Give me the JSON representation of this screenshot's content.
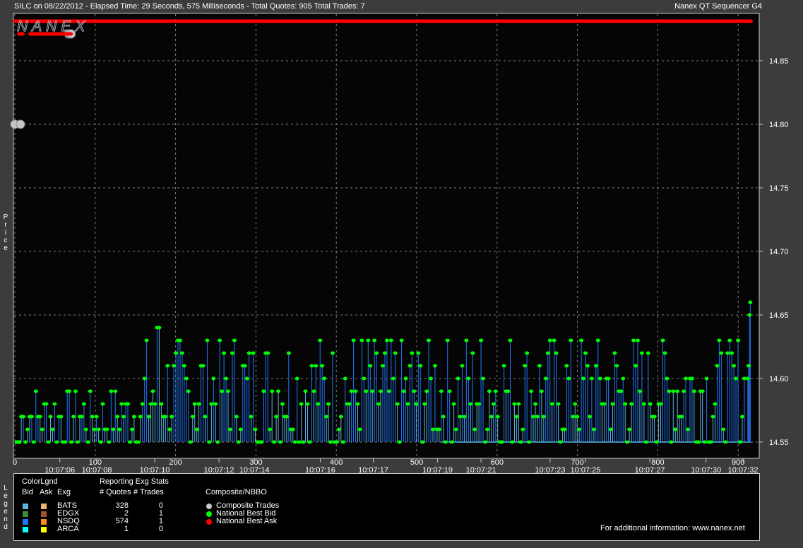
{
  "header": {
    "left": "SILC on 08/22/2012  -  Elapsed Time: 29 Seconds, 575 Milliseconds  -  Total Quotes: 905  Total Trades: 7",
    "right": "Nanex QT Sequencer G4"
  },
  "watermark": "NANEX",
  "y_axis_label": "Price",
  "legend_side_label": "Legend",
  "chart_data": {
    "type": "scatter",
    "ylabel": "Price",
    "ylim": [
      14.545,
      14.875
    ],
    "xlim": [
      0,
      920
    ],
    "y_ticks": [
      "14.55",
      "14.60",
      "14.65",
      "14.70",
      "14.75",
      "14.80",
      "14.85"
    ],
    "x_ticks": [
      "0",
      "100",
      "200",
      "300",
      "400",
      "500",
      "600",
      "700",
      "800",
      "900"
    ],
    "time_labels": [
      {
        "x": 28,
        "label": "10:07:06"
      },
      {
        "x": 51,
        "label": "10:07:08"
      },
      {
        "x": 87,
        "label": "10:07:10"
      },
      {
        "x": 127,
        "label": "10:07:12"
      },
      {
        "x": 149,
        "label": "10:07:14"
      },
      {
        "x": 190,
        "label": "10:07:16"
      },
      {
        "x": 223,
        "label": "10:07:17"
      },
      {
        "x": 263,
        "label": "10:07:19"
      },
      {
        "x": 290,
        "label": "10:07:21"
      },
      {
        "x": 333,
        "label": "10:07:23"
      },
      {
        "x": 355,
        "label": "10:07:25"
      },
      {
        "x": 395,
        "label": "10:07:27"
      },
      {
        "x": 430,
        "label": "10:07:30"
      },
      {
        "x": 453,
        "label": "10:07:32"
      }
    ],
    "grid": true,
    "series": [
      {
        "name": "National Best Ask",
        "color": "#ff0000",
        "segments": [
          [
            0,
            14.875,
            70,
            14.875
          ],
          [
            5,
            14.865,
            10,
            14.865
          ],
          [
            19,
            14.865,
            70,
            14.865
          ],
          [
            70,
            14.875,
            916,
            14.875
          ]
        ]
      },
      {
        "name": "Composite Trades",
        "color": "#c8c8c8",
        "values": [
          [
            0,
            14.8
          ],
          [
            7,
            14.8
          ],
          [
            67,
            14.865
          ],
          [
            69,
            14.865
          ],
          [
            70,
            14.865
          ]
        ]
      },
      {
        "name": "National Best Bid",
        "color": "#00ff00",
        "note_levels": [
          14.55,
          14.56,
          14.57,
          14.58,
          14.59,
          14.6,
          14.61,
          14.62,
          14.63,
          14.64,
          14.65,
          14.66
        ],
        "end_values": [
          [
            912,
            14.6
          ],
          [
            913,
            14.61
          ],
          [
            914,
            14.65
          ],
          [
            915,
            14.66
          ]
        ]
      }
    ]
  },
  "legend": {
    "colorlgnd": "ColorLgnd",
    "reporting": "Reporting Exg Stats",
    "h_bid": "Bid",
    "h_ask": "Ask",
    "h_exg": "Exg",
    "h_quotes": "# Quotes",
    "h_trades": "# Trades",
    "composite": "Composite/NBBO",
    "rows": [
      {
        "exg": "BATS",
        "quotes": "328",
        "trades": "0",
        "bid_color": "#5ab4e6",
        "ask_color": "#f0b464"
      },
      {
        "exg": "EDGX",
        "quotes": "2",
        "trades": "1",
        "bid_color": "#3c8c3c",
        "ask_color": "#a0522d"
      },
      {
        "exg": "NSDQ",
        "quotes": "574",
        "trades": "1",
        "bid_color": "#1e78ff",
        "ask_color": "#ff8c1e"
      },
      {
        "exg": "ARCA",
        "quotes": "1",
        "trades": "0",
        "bid_color": "#00ffff",
        "ask_color": "#ffff00"
      }
    ],
    "nbbo": [
      {
        "label": "Composite Trades",
        "color": "#c8c8c8"
      },
      {
        "label": "National Best Bid",
        "color": "#00ff00"
      },
      {
        "label": "National Best Ask",
        "color": "#ff0000"
      }
    ],
    "info": "For additional information: www.nanex.net"
  }
}
